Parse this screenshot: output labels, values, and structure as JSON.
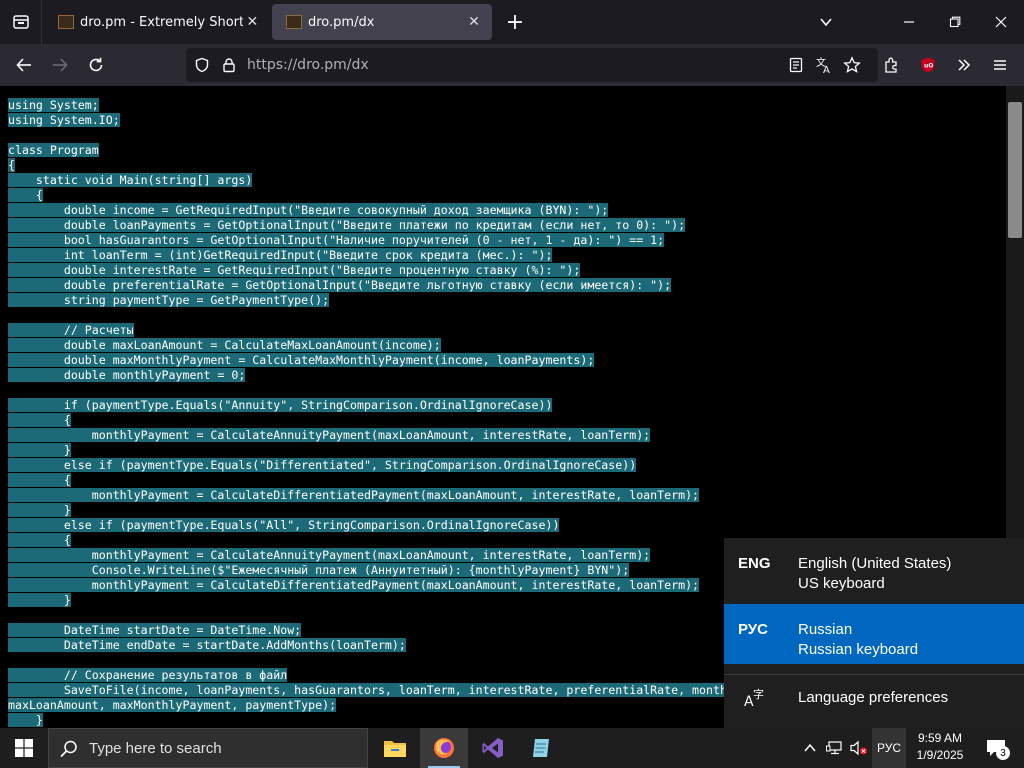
{
  "browser": {
    "tabs": [
      {
        "title": "dro.pm - Extremely Short Links",
        "active": false
      },
      {
        "title": "dro.pm/dx",
        "active": true
      }
    ],
    "url": "https://dro.pm/dx",
    "icons": {
      "tab_list": "tab-list-icon",
      "new_tab": "plus-icon",
      "tabs_menu": "chevron-down-icon",
      "back": "arrow-left-icon",
      "forward": "arrow-right-icon",
      "reload": "reload-icon",
      "shield": "shield-icon",
      "lock": "lock-icon",
      "reader": "reader-view-icon",
      "translate": "translate-icon",
      "bookmark": "star-icon",
      "extensions": "puzzle-icon",
      "ublock": "ublock-icon",
      "overflow": "double-chevron-icon",
      "menu": "hamburger-icon"
    }
  },
  "page": {
    "code_lines": [
      "using System;",
      "using System.IO;",
      "",
      "class Program",
      "{",
      "    static void Main(string[] args)",
      "    {",
      "        double income = GetRequiredInput(\"Введите совокупный доход заемщика (BYN): \");",
      "        double loanPayments = GetOptionalInput(\"Введите платежи по кредитам (если нет, то 0): \");",
      "        bool hasGuarantors = GetOptionalInput(\"Наличие поручителей (0 - нет, 1 - да): \") == 1;",
      "        int loanTerm = (int)GetRequiredInput(\"Введите срок кредита (мес.): \");",
      "        double interestRate = GetRequiredInput(\"Введите процентную ставку (%): \");",
      "        double preferentialRate = GetOptionalInput(\"Введите льготную ставку (если имеется): \");",
      "        string paymentType = GetPaymentType();",
      "",
      "        // Расчеты",
      "        double maxLoanAmount = CalculateMaxLoanAmount(income);",
      "        double maxMonthlyPayment = CalculateMaxMonthlyPayment(income, loanPayments);",
      "        double monthlyPayment = 0;",
      "",
      "        if (paymentType.Equals(\"Annuity\", StringComparison.OrdinalIgnoreCase))",
      "        {",
      "            monthlyPayment = CalculateAnnuityPayment(maxLoanAmount, interestRate, loanTerm);",
      "        }",
      "        else if (paymentType.Equals(\"Differentiated\", StringComparison.OrdinalIgnoreCase))",
      "        {",
      "            monthlyPayment = CalculateDifferentiatedPayment(maxLoanAmount, interestRate, loanTerm);",
      "        }",
      "        else if (paymentType.Equals(\"All\", StringComparison.OrdinalIgnoreCase))",
      "        {",
      "            monthlyPayment = CalculateAnnuityPayment(maxLoanAmount, interestRate, loanTerm);",
      "            Console.WriteLine($\"Ежемесячный платеж (Аннуитетный): {monthlyPayment} BYN\");",
      "            monthlyPayment = CalculateDifferentiatedPayment(maxLoanAmount, interestRate, loanTerm);",
      "        }",
      "",
      "        DateTime startDate = DateTime.Now;",
      "        DateTime endDate = startDate.AddMonths(loanTerm);",
      "",
      "        // Сохранение результатов в файл",
      "        SaveToFile(income, loanPayments, hasGuarantors, loanTerm, interestRate, preferentialRate, monthlyPayment, startDate, endDate,",
      "maxLoanAmount, maxMonthlyPayment, paymentType);",
      "    }"
    ],
    "selection_color": "#1c6a78"
  },
  "language_popup": {
    "items": [
      {
        "code": "ENG",
        "name": "English (United States)",
        "keyboard": "US keyboard",
        "selected": false
      },
      {
        "code": "РУС",
        "name": "Russian",
        "keyboard": "Russian keyboard",
        "selected": true
      }
    ],
    "preferences_label": "Language preferences",
    "preferences_icon": "language-settings-icon",
    "accent_color": "#0067c0"
  },
  "taskbar": {
    "search_placeholder": "Type here to search",
    "apps": [
      {
        "name": "file-explorer",
        "icon": "folder-icon",
        "active": false
      },
      {
        "name": "firefox",
        "icon": "firefox-icon",
        "active": true
      },
      {
        "name": "visual-studio",
        "icon": "visual-studio-icon",
        "active": false
      },
      {
        "name": "notepad",
        "icon": "notepad-icon",
        "active": false
      }
    ],
    "tray_language": "РУС",
    "time": "9:59 AM",
    "date": "1/9/2025",
    "notification_count": "3"
  }
}
